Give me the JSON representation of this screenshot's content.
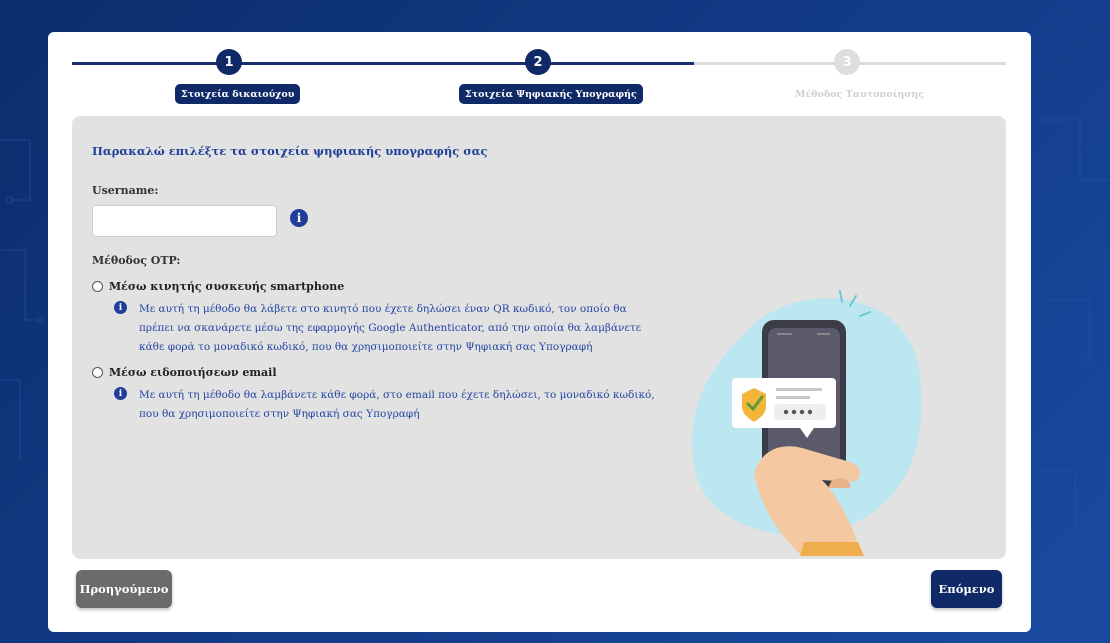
{
  "stepper": {
    "steps": [
      {
        "number": "1",
        "label": "Στοιχεία δικαιούχου",
        "state": "completed"
      },
      {
        "number": "2",
        "label": "Στοιχεία Ψηφιακής Υπογραφής",
        "state": "active"
      },
      {
        "number": "3",
        "label": "Μέθοδος Ταυτοποίησης",
        "state": "upcoming"
      }
    ]
  },
  "form": {
    "intro": "Παρακαλώ επιλέξτε τα στοιχεία ψηφιακής υπογραφής σας",
    "username_label": "Username:",
    "username_value": "",
    "username_info_icon": "info-icon",
    "otp_label": "Μέθοδος OTP:",
    "options": [
      {
        "label": "Μέσω κινητής συσκευής smartphone",
        "selected": false,
        "description": "Με αυτή τη μέθοδο θα λάβετε στο κινητό που έχετε δηλώσει έναν QR κωδικό, τον οποίο θα πρέπει να σκανάρετε μέσω της εφαρμογής Google Authenticator, από την οποία θα λαμβάνετε κάθε φορά το μοναδικό κωδικό, που θα χρησιμοποιείτε στην Ψηφιακή σας Υπογραφή"
      },
      {
        "label": "Μέσω ειδοποιήσεων email",
        "selected": false,
        "description": "Με αυτή τη μέθοδο θα λαμβάνετε κάθε φορά, στο email που έχετε δηλώσει, το μοναδικό κωδικό, που θα χρησιμοποιείτε στην Ψηφιακή σας Υπογραφή"
      }
    ]
  },
  "buttons": {
    "previous": "Προηγούμενο",
    "next": "Επόμενο"
  },
  "colors": {
    "primary": "#0f2a66",
    "link_text": "#2446a3",
    "panel": "#e2e2e2",
    "previous_button": "#6b6b6b"
  }
}
